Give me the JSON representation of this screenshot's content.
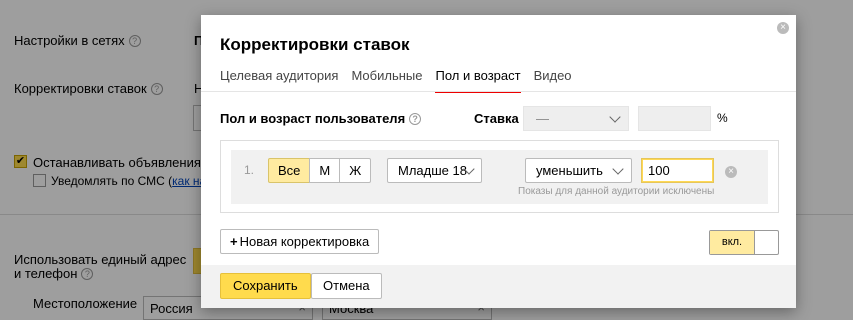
{
  "background": {
    "network_settings_label": "Настройки в сетях",
    "network_settings_value": "П",
    "bid_adjustments_label": "Корректировки ставок",
    "bid_adjustments_value": "Н",
    "stop_ads_label": "Останавливать объявления при",
    "sms_label": "Уведомлять по СМС (",
    "sms_link": "как нас",
    "single_address_label_line1": "Использовать единый адрес",
    "single_address_label_line2": "и телефон",
    "location_label": "Местоположение",
    "country_value": "Россия",
    "city_value": "Москва"
  },
  "modal": {
    "title": "Корректировки ставок",
    "tabs": [
      {
        "label": "Целевая аудитория",
        "active": false
      },
      {
        "label": "Мобильные",
        "active": false
      },
      {
        "label": "Пол и возраст",
        "active": true
      },
      {
        "label": "Видео",
        "active": false
      }
    ],
    "section_label": "Пол и возраст пользователя",
    "rate_label": "Ставка",
    "rate_select_value": "—",
    "rate_input_value": "",
    "percent_sign": "%",
    "rule": {
      "number": "1.",
      "gender_options": [
        {
          "label": "Все",
          "active": true
        },
        {
          "label": "М",
          "active": false
        },
        {
          "label": "Ж",
          "active": false
        }
      ],
      "age_value": "Младше 18",
      "direction_value": "уменьшить",
      "value": "100",
      "hint": "Показы для данной аудитории исключены"
    },
    "new_adjustment_label": "Новая корректировка",
    "toggle_label": "вкл.",
    "save_label": "Сохранить",
    "cancel_label": "Отмена"
  }
}
